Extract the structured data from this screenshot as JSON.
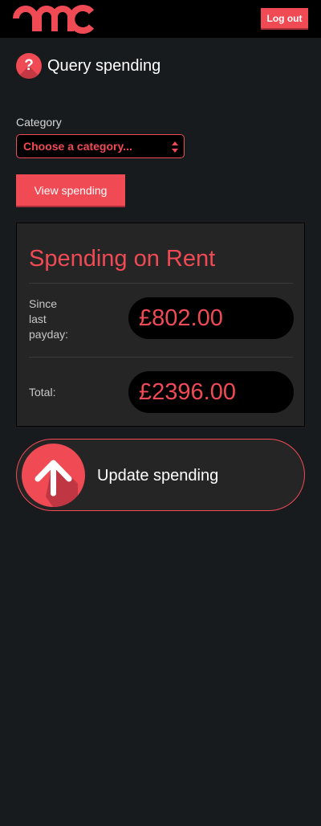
{
  "header": {
    "logo_text": "amc",
    "logout_label": "Log out"
  },
  "page": {
    "title": "Query spending",
    "help_icon_glyph": "?"
  },
  "form": {
    "category_label": "Category",
    "category_selected": "Choose a category...",
    "view_button_label": "View spending"
  },
  "panel": {
    "title": "Spending on Rent",
    "since_label": "Since last payday:",
    "since_value": "£802.00",
    "total_label": "Total:",
    "total_value": "£2396.00"
  },
  "update": {
    "label": "Update spending",
    "icon": "arrow-up-icon"
  },
  "colors": {
    "accent": "#f04a55",
    "background": "#181b1e",
    "panel": "#252525",
    "header": "#000000"
  }
}
